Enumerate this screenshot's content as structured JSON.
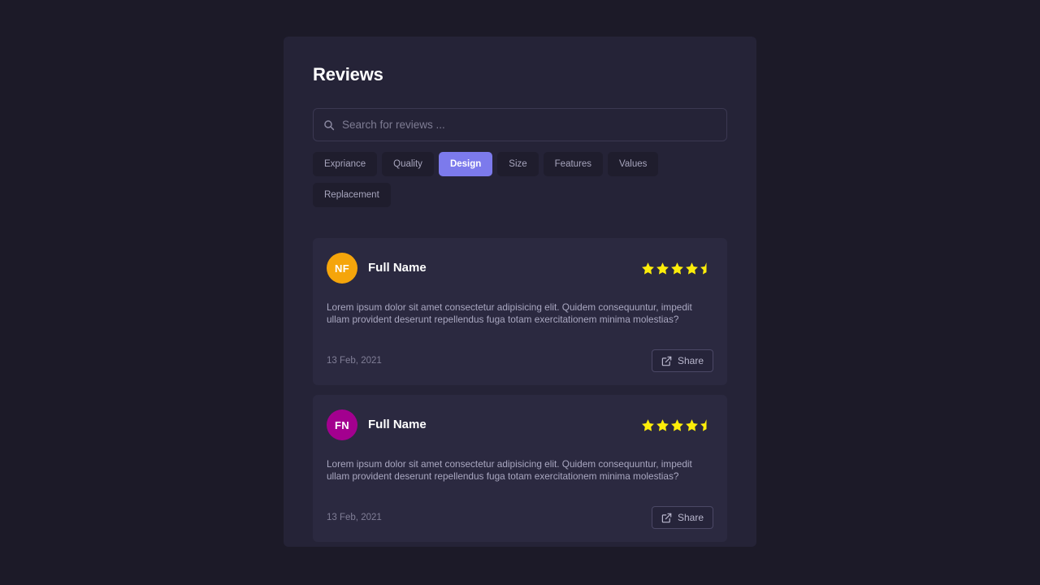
{
  "page": {
    "title": "Reviews",
    "background_color": "#1c1a28",
    "panel_color": "#252337"
  },
  "search": {
    "placeholder": "Search for reviews ...",
    "value": "",
    "icon": "search-icon"
  },
  "filters": {
    "active": "Design",
    "active_color": "#7c7aec",
    "items": [
      {
        "label": "Expriance",
        "active": false
      },
      {
        "label": "Quality",
        "active": false
      },
      {
        "label": "Design",
        "active": true
      },
      {
        "label": "Size",
        "active": false
      },
      {
        "label": "Features",
        "active": false
      },
      {
        "label": "Values",
        "active": false
      },
      {
        "label": "Replacement",
        "active": false
      }
    ]
  },
  "reviews": [
    {
      "initials": "NF",
      "avatar_color": "#f5a50b",
      "name": "Full Name",
      "rating": 4.5,
      "rating_max": 5,
      "star_color": "#fced0a",
      "body": "Lorem ipsum dolor sit amet consectetur adipisicing elit. Quidem consequuntur, impedit ullam provident deserunt repellendus fuga totam exercitationem minima molestias?",
      "date": "13 Feb, 2021",
      "share_label": "Share",
      "share_icon": "external-link-icon"
    },
    {
      "initials": "FN",
      "avatar_color": "#a3008f",
      "name": "Full Name",
      "rating": 4.5,
      "rating_max": 5,
      "star_color": "#fced0a",
      "body": "Lorem ipsum dolor sit amet consectetur adipisicing elit. Quidem consequuntur, impedit ullam provident deserunt repellendus fuga totam exercitationem minima molestias?",
      "date": "13 Feb, 2021",
      "share_label": "Share",
      "share_icon": "external-link-icon"
    }
  ]
}
